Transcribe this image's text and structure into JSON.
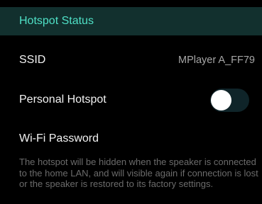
{
  "colors": {
    "background": "#000000",
    "header_background": "#12302e",
    "header_text": "#4fe0c6",
    "label_text": "#f2f2f2",
    "value_text": "#a6a6a6",
    "description_text": "#6b6b6b",
    "toggle_track_off": "#0f2429",
    "toggle_knob": "#ffffff"
  },
  "section": {
    "title": "Hotspot Status"
  },
  "ssid": {
    "label": "SSID",
    "value": "MPlayer A_FF79"
  },
  "personal_hotspot": {
    "label": "Personal Hotspot",
    "enabled": false
  },
  "wifi_password": {
    "label": "Wi-Fi Password",
    "description": "The hotspot will be hidden when the speaker is connected to the home LAN, and will visible again if connection is lost or the speaker is restored to its factory settings."
  }
}
